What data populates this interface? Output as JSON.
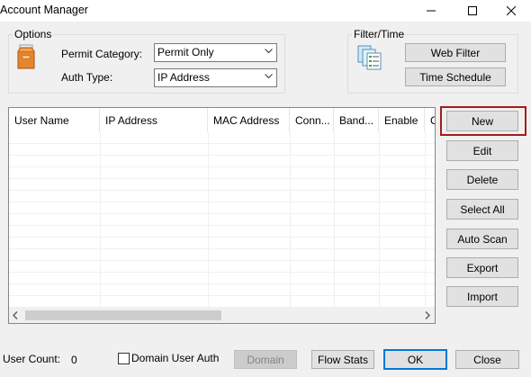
{
  "window": {
    "title": "Account Manager"
  },
  "options": {
    "legend": "Options",
    "permit_category_label": "Permit Category:",
    "permit_category_value": "Permit Only",
    "auth_type_label": "Auth Type:",
    "auth_type_value": "IP Address"
  },
  "filter_time": {
    "legend": "Filter/Time",
    "web_filter_label": "Web Filter",
    "time_schedule_label": "Time Schedule"
  },
  "table": {
    "columns": [
      "User Name",
      "IP Address",
      "MAC Address",
      "Conn...",
      "Band...",
      "Enable",
      "C"
    ],
    "rows": []
  },
  "actions": {
    "new_label": "New",
    "edit_label": "Edit",
    "delete_label": "Delete",
    "select_all_label": "Select All",
    "auto_scan_label": "Auto Scan",
    "export_label": "Export",
    "import_label": "Import"
  },
  "footer": {
    "user_count_label": "User Count:",
    "user_count_value": "0",
    "domain_user_auth_label": "Domain User Auth",
    "domain_label": "Domain",
    "flow_stats_label": "Flow Stats",
    "ok_label": "OK",
    "close_label": "Close"
  },
  "colors": {
    "highlight": "#a51b1b",
    "ok_border": "#0078d7"
  }
}
